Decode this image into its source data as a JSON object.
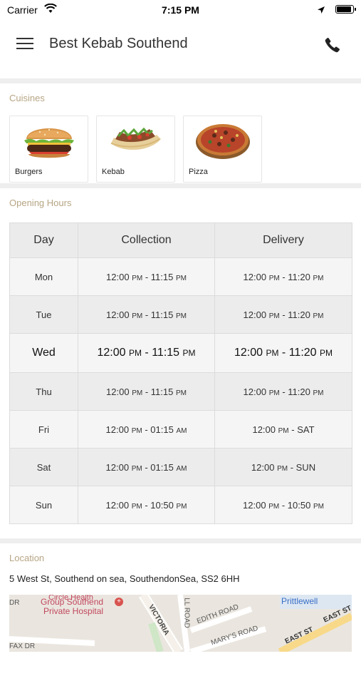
{
  "status_bar": {
    "carrier": "Carrier",
    "time": "7:15 PM"
  },
  "header": {
    "title": "Best Kebab Southend"
  },
  "cuisines": {
    "title": "Cuisines",
    "items": [
      {
        "label": "Burgers",
        "icon": "burger-image"
      },
      {
        "label": "Kebab",
        "icon": "kebab-image"
      },
      {
        "label": "Pizza",
        "icon": "pizza-image"
      }
    ]
  },
  "opening_hours": {
    "title": "Opening Hours",
    "columns": [
      "Day",
      "Collection",
      "Delivery"
    ],
    "rows": [
      {
        "day": "Mon",
        "collection": {
          "start": "12:00",
          "start_period": "PM",
          "end": "11:15",
          "end_period": "PM"
        },
        "delivery": {
          "start": "12:00",
          "start_period": "PM",
          "end": "11:20",
          "end_period": "PM"
        }
      },
      {
        "day": "Tue",
        "collection": {
          "start": "12:00",
          "start_period": "PM",
          "end": "11:15",
          "end_period": "PM"
        },
        "delivery": {
          "start": "12:00",
          "start_period": "PM",
          "end": "11:20",
          "end_period": "PM"
        }
      },
      {
        "day": "Wed",
        "collection": {
          "start": "12:00",
          "start_period": "PM",
          "end": "11:15",
          "end_period": "PM"
        },
        "delivery": {
          "start": "12:00",
          "start_period": "PM",
          "end": "11:20",
          "end_period": "PM"
        }
      },
      {
        "day": "Thu",
        "collection": {
          "start": "12:00",
          "start_period": "PM",
          "end": "11:15",
          "end_period": "PM"
        },
        "delivery": {
          "start": "12:00",
          "start_period": "PM",
          "end": "11:20",
          "end_period": "PM"
        }
      },
      {
        "day": "Fri",
        "collection": {
          "start": "12:00",
          "start_period": "PM",
          "end": "01:15",
          "end_period": "AM"
        },
        "delivery": {
          "start": "12:00",
          "start_period": "PM",
          "end": "SAT",
          "end_period": ""
        }
      },
      {
        "day": "Sat",
        "collection": {
          "start": "12:00",
          "start_period": "PM",
          "end": "01:15",
          "end_period": "AM"
        },
        "delivery": {
          "start": "12:00",
          "start_period": "PM",
          "end": "SUN",
          "end_period": ""
        }
      },
      {
        "day": "Sun",
        "collection": {
          "start": "12:00",
          "start_period": "PM",
          "end": "10:50",
          "end_period": "PM"
        },
        "delivery": {
          "start": "12:00",
          "start_period": "PM",
          "end": "10:50",
          "end_period": "PM"
        }
      }
    ],
    "highlighted_day": "Wed"
  },
  "location": {
    "title": "Location",
    "address": "5 West St, Southend on sea, SouthendonSea, SS2 6HH",
    "map_labels": {
      "hospital_line1": "Group Southend",
      "hospital_line2": "Private Hospital",
      "hospital_top": "Circle Health",
      "prittlewell": "Prittlewell",
      "victoria": "VICTORIA",
      "edith_road": "EDITH ROAD",
      "marys_road": "MARY'S ROAD",
      "east_st": "EAST ST",
      "east_st_2": "EAST ST",
      "fax_dr": "FAX DR",
      "ll_road": "LL ROAD",
      "dr": "DR"
    }
  },
  "colors": {
    "section_title": "#b7a584",
    "divider": "#eeeeee",
    "map_poi": "#c2475e",
    "map_link": "#3a6fc6"
  }
}
